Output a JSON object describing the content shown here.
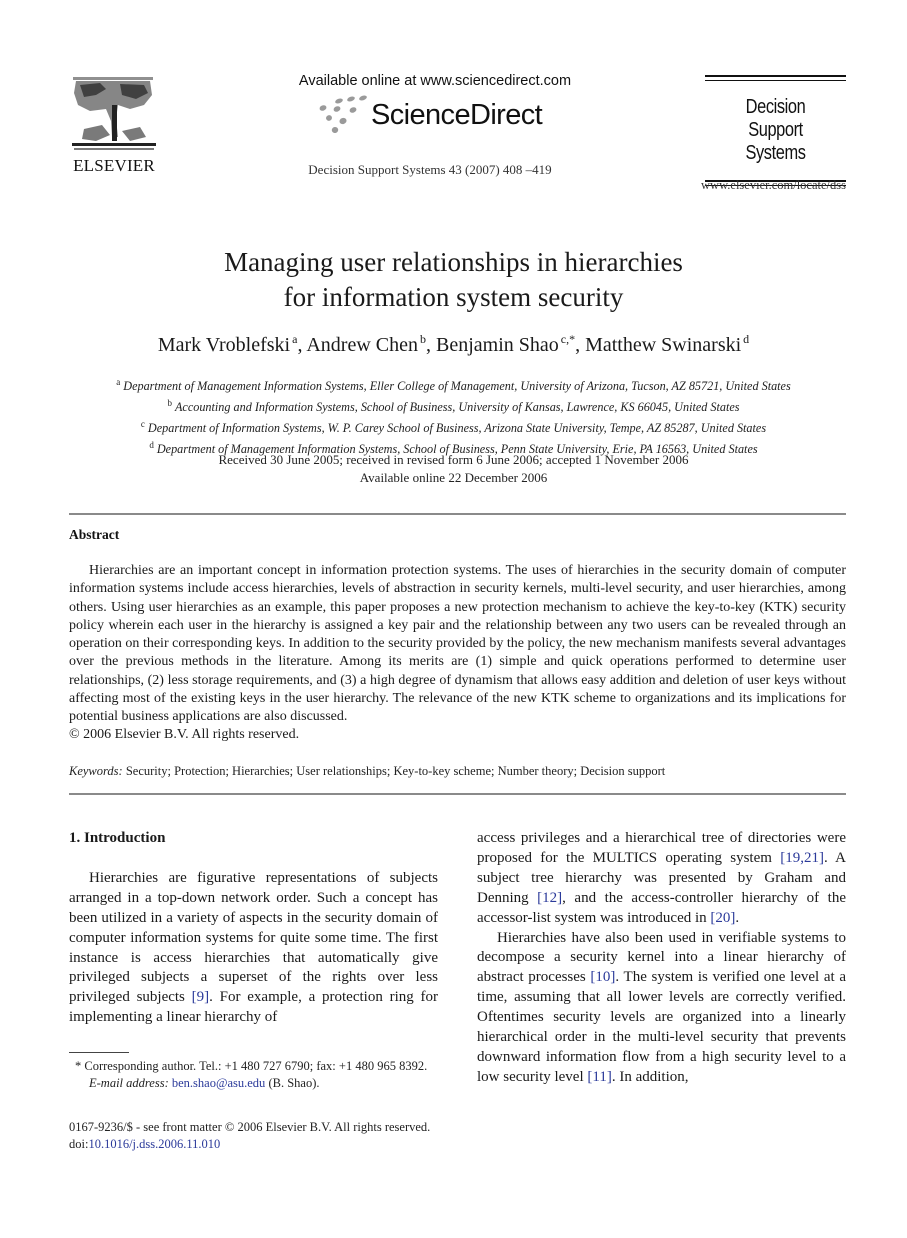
{
  "header": {
    "publisher_name": "ELSEVIER",
    "available_online": "Available online at www.sciencedirect.com",
    "platform_name": "ScienceDirect",
    "journal_citation": "Decision Support Systems 43 (2007) 408 –419",
    "journal_title_line1": "Decision Support",
    "journal_title_line2": "Systems",
    "journal_url": "www.elsevier.com/locate/dss"
  },
  "paper": {
    "title_line1": "Managing user relationships in hierarchies",
    "title_line2": "for information system security",
    "authors": [
      {
        "name": "Mark Vroblefski",
        "affil": "a",
        "sep": ", "
      },
      {
        "name": "Andrew Chen",
        "affil": "b",
        "sep": ", "
      },
      {
        "name": "Benjamin Shao",
        "affil": "c,*",
        "sep": ", "
      },
      {
        "name": "Matthew Swinarski",
        "affil": "d",
        "sep": ""
      }
    ],
    "affiliations": [
      {
        "mark": "a",
        "text": "Department of Management Information Systems, Eller College of Management, University of Arizona, Tucson, AZ 85721, United States"
      },
      {
        "mark": "b",
        "text": "Accounting and Information Systems, School of Business, University of Kansas, Lawrence, KS 66045, United States"
      },
      {
        "mark": "c",
        "text": "Department of Information Systems, W. P. Carey School of Business, Arizona State University, Tempe, AZ 85287, United States"
      },
      {
        "mark": "d",
        "text": "Department of Management Information Systems, School of Business, Penn State University, Erie, PA 16563, United States"
      }
    ],
    "dates_line1": "Received 30 June 2005; received in revised form 6 June 2006; accepted 1 November 2006",
    "dates_line2": "Available online 22 December 2006"
  },
  "abstract": {
    "heading": "Abstract",
    "body": "Hierarchies are an important concept in information protection systems. The uses of hierarchies in the security domain of computer information systems include access hierarchies, levels of abstraction in security kernels, multi-level security, and user hierarchies, among others. Using user hierarchies as an example, this paper proposes a new protection mechanism to achieve the key-to-key (KTK) security policy wherein each user in the hierarchy is assigned a key pair and the relationship between any two users can be revealed through an operation on their corresponding keys. In addition to the security provided by the policy, the new mechanism manifests several advantages over the previous methods in the literature. Among its merits are (1) simple and quick operations performed to determine user relationships, (2) less storage requirements, and (3) a high degree of dynamism that allows easy addition and deletion of user keys without affecting most of the existing keys in the user hierarchy. The relevance of the new KTK scheme to organizations and its implications for potential business applications are also discussed.",
    "copyright": "© 2006 Elsevier B.V. All rights reserved."
  },
  "keywords": {
    "label": "Keywords:",
    "text": "Security; Protection; Hierarchies; User relationships; Key-to-key scheme; Number theory; Decision support"
  },
  "introduction": {
    "heading": "1. Introduction",
    "left_para": [
      {
        "t": "Hierarchies are figurative representations of subjects arranged in a top-down network order. Such a concept has been utilized in a variety of aspects in the security domain of computer information systems for quite some time. The first instance is access hierarchies that automatically give privileged subjects a superset of the rights over less privileged subjects "
      },
      {
        "ref": "[9]"
      },
      {
        "t": ". For example, a protection ring for implementing a linear hierarchy of"
      }
    ],
    "right_para1": [
      {
        "t": "access privileges and a hierarchical tree of directories were proposed for the MULTICS operating system "
      },
      {
        "ref": "[19,21]"
      },
      {
        "t": ". A subject tree hierarchy was presented by Graham and Denning "
      },
      {
        "ref": "[12]"
      },
      {
        "t": ", and the access-controller hierarchy of the accessor-list system was introduced in "
      },
      {
        "ref": "[20]"
      },
      {
        "t": "."
      }
    ],
    "right_para2": [
      {
        "t": "Hierarchies have also been used in verifiable systems to decompose a security kernel into a linear hierarchy of abstract processes "
      },
      {
        "ref": "[10]"
      },
      {
        "t": ". The system is verified one level at a time, assuming that all lower levels are correctly verified. Oftentimes security levels are organized into a linearly hierarchical order in the multi-level security that prevents downward information flow from a high security level to a low security level "
      },
      {
        "ref": "[11]"
      },
      {
        "t": ". In addition,"
      }
    ]
  },
  "footnote": {
    "corresponding": "* Corresponding author. Tel.: +1 480 727 6790; fax: +1 480 965 8392.",
    "email_label": "E-mail address:",
    "email": "ben.shao@asu.edu",
    "email_suffix": " (B. Shao)."
  },
  "front_matter": {
    "issn_line": "0167-9236/$ - see front matter © 2006 Elsevier B.V. All rights reserved.",
    "doi_prefix": "doi:",
    "doi": "10.1016/j.dss.2006.11.010"
  },
  "colors": {
    "link": "#2b3a9a",
    "rule": "#8a8a8a",
    "sd_dots": "#9a9a9a"
  }
}
